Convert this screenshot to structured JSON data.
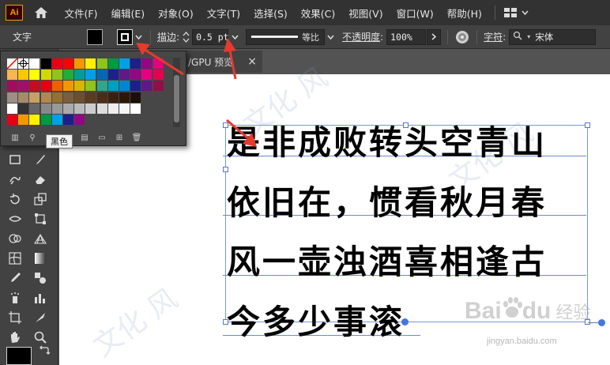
{
  "app": {
    "logo": "Ai",
    "home_icon": "home-icon"
  },
  "menu": [
    "文件(F)",
    "编辑(E)",
    "对象(O)",
    "文字(T)",
    "选择(S)",
    "效果(C)",
    "视图(V)",
    "窗口(W)",
    "帮助(H)"
  ],
  "control": {
    "tool_label": "文字",
    "stroke_label": "描边",
    "stroke_weight": "0.5 pt",
    "stroke_profile": "等比",
    "opacity_label": "不透明度",
    "opacity_value": "100%",
    "char_label": "字符",
    "font_name": "宋体"
  },
  "document_tab": {
    "label": "/GPU 预览",
    "close": "×"
  },
  "swatch_panel": {
    "tooltip": "黑色",
    "rows": [
      [
        "#ffffff",
        "#ffffff",
        "#ffffff",
        "#000000",
        "#e60012",
        "#ff0000",
        "#f39800",
        "#fff100",
        "#8fc31f",
        "#009944",
        "#00a0e9",
        "#1d2088",
        "#920783",
        "#e4007f"
      ],
      [
        "#f8b551",
        "#fcc800",
        "#ffff00",
        "#cfdb00",
        "#8fc31f",
        "#22ac38",
        "#009e96",
        "#00a0e9",
        "#0068b7",
        "#1d2088",
        "#601986",
        "#920783",
        "#e4007f",
        "#e5004f"
      ],
      [
        "#a40b5d",
        "#a0106b",
        "#c30d23",
        "#e60012",
        "#eb6100",
        "#f39800",
        "#d7b600",
        "#8fc31f",
        "#32a58c",
        "#00a0c1",
        "#0086d1",
        "#1d2088",
        "#5f1985",
        "#930e49"
      ],
      [
        "#9e8f85",
        "#a58b6c",
        "#c9a063",
        "#b28850",
        "#966f33",
        "#7c5e3c",
        "#6b4f2f",
        "#5a3c22",
        "#4b2d18",
        "#3b2010",
        "#2b1708",
        "#1e0f04"
      ],
      [
        "#ffffff",
        "#333333",
        "#666666",
        "#888888",
        "#999999",
        "#aaaaaa",
        "#bbbbbb",
        "#cccccc",
        "#dddddd",
        "#eeeeee",
        "#f5f5f5",
        "#ffffff"
      ],
      [
        "#e60012",
        "#f39800",
        "#fff100",
        "#009944",
        "#00a0e9",
        "#1d2088",
        "#920783"
      ]
    ]
  },
  "poem": [
    "是非成败转头空青山",
    "依旧在，惯看秋月春",
    "风一壶浊酒喜相逢古",
    "今多少事滚"
  ],
  "watermark": {
    "brand": "Bai",
    "paw": "du",
    "sub": "经验",
    "url": "jingyan.baidu.com"
  }
}
